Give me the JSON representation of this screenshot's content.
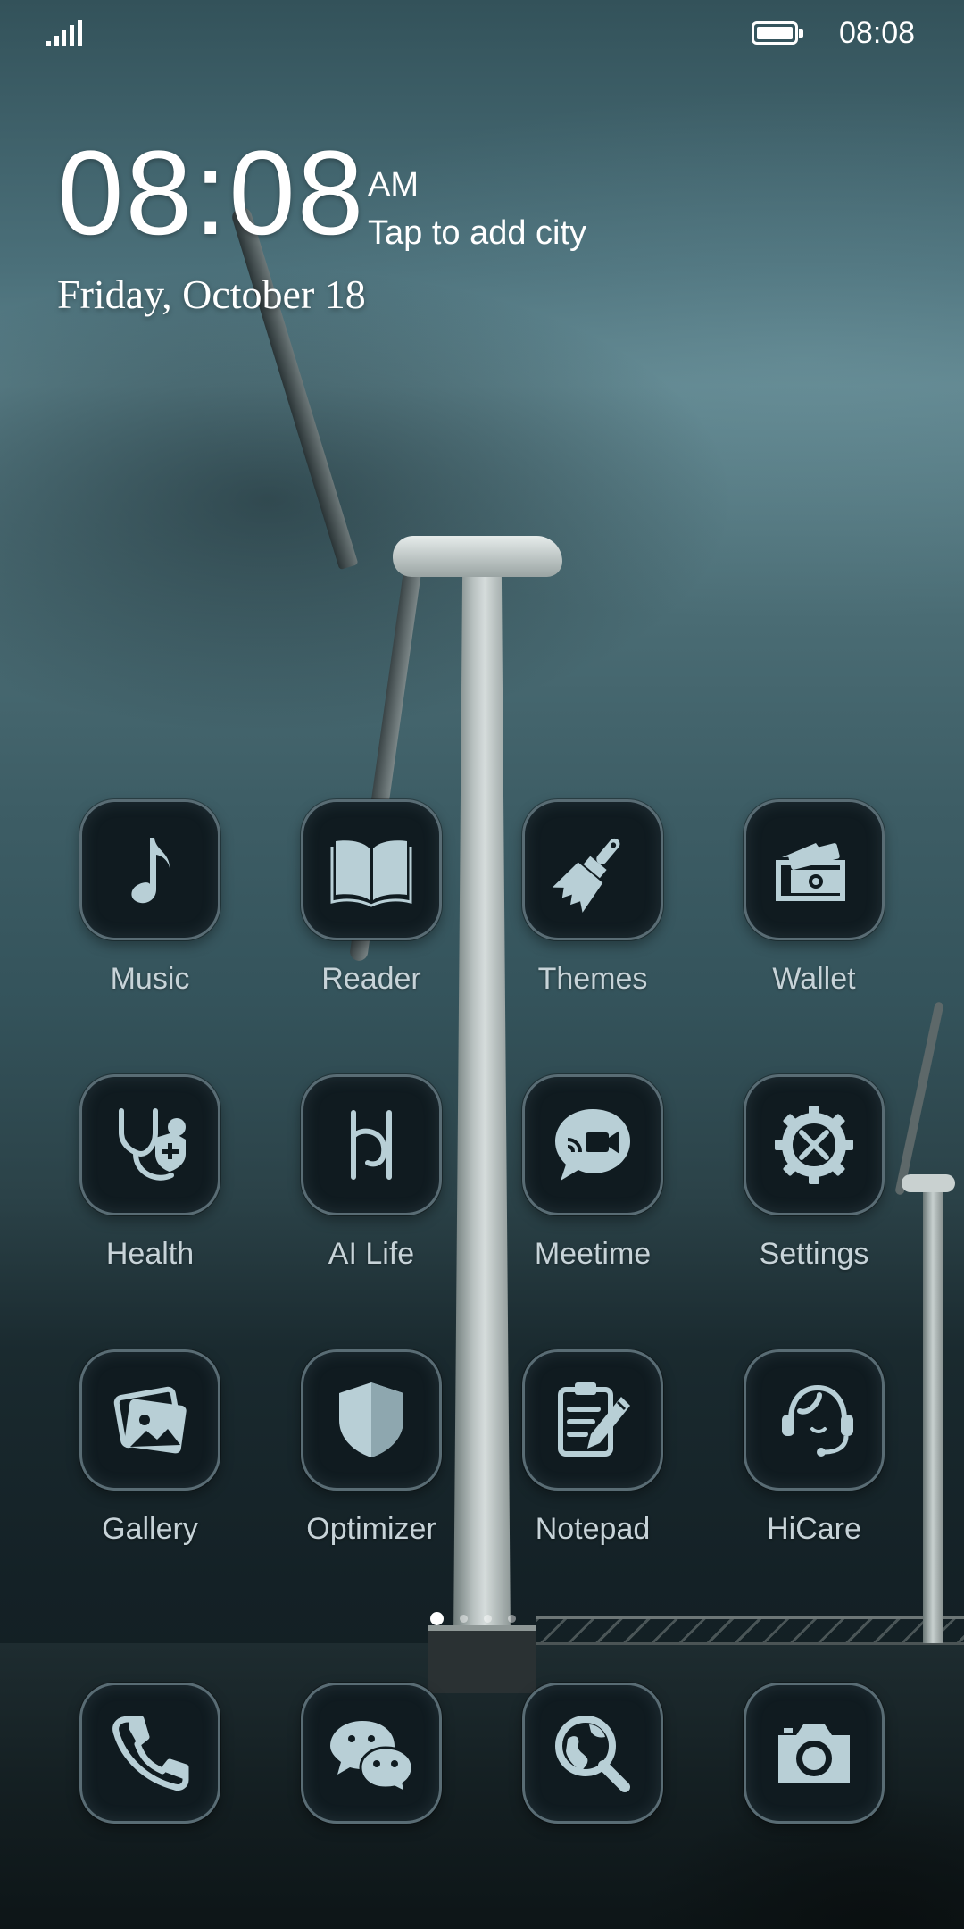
{
  "status_bar": {
    "time": "08:08",
    "signal_icon": "signal-icon",
    "battery_icon": "battery-icon"
  },
  "clock_widget": {
    "time": "08:08",
    "ampm": "AM",
    "city_prompt": "Tap to add city",
    "date": "Friday, October 18"
  },
  "apps": [
    {
      "label": "Music",
      "icon": "music-note-icon"
    },
    {
      "label": "Reader",
      "icon": "book-icon"
    },
    {
      "label": "Themes",
      "icon": "paintbrush-icon"
    },
    {
      "label": "Wallet",
      "icon": "wallet-icon"
    },
    {
      "label": "Health",
      "icon": "stethoscope-icon"
    },
    {
      "label": "AI Life",
      "icon": "ai-life-icon"
    },
    {
      "label": "Meetime",
      "icon": "video-chat-icon"
    },
    {
      "label": "Settings",
      "icon": "gear-tools-icon"
    },
    {
      "label": "Gallery",
      "icon": "photos-icon"
    },
    {
      "label": "Optimizer",
      "icon": "shield-icon"
    },
    {
      "label": "Notepad",
      "icon": "notepad-pencil-icon"
    },
    {
      "label": "HiCare",
      "icon": "headset-icon"
    }
  ],
  "dock": [
    {
      "icon": "phone-icon"
    },
    {
      "icon": "chat-bubbles-icon"
    },
    {
      "icon": "globe-search-icon"
    },
    {
      "icon": "camera-icon"
    }
  ],
  "page_indicator": {
    "pages": 4,
    "active": 1
  },
  "colors": {
    "icon_glyph": "#b8cfd6",
    "icon_bg": "#101b20",
    "label": "#c7d3d8"
  }
}
